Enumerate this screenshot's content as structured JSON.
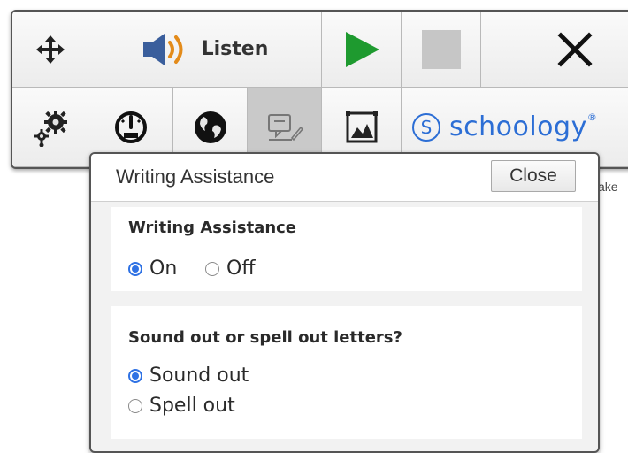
{
  "toolbar": {
    "listen_label": "Listen",
    "schoology_mark": "S",
    "schoology_label": "schoology",
    "schoology_trademark": "®",
    "icons": {
      "move": "move-arrows-icon",
      "speaker": "speaker-icon",
      "play": "play-icon",
      "stop": "stop-icon",
      "close": "close-icon",
      "settings": "gears-icon",
      "speed": "speedometer-icon",
      "globe": "globe-icon",
      "writing": "writing-assistance-icon",
      "picture": "picture-dictionary-icon"
    },
    "colors": {
      "play": "#1e9a2f",
      "speaker": "#3a5e9c",
      "speaker_waves": "#e38b1a",
      "stop": "#c6c6c6",
      "schoology": "#2c6ed5"
    }
  },
  "behind_text": "ake",
  "popup": {
    "title": "Writing Assistance",
    "close_label": "Close",
    "writing_section": {
      "heading": "Writing Assistance",
      "options": [
        {
          "label": "On",
          "selected": true
        },
        {
          "label": "Off",
          "selected": false
        }
      ]
    },
    "sound_section": {
      "heading": "Sound out or spell out letters?",
      "options": [
        {
          "label": "Sound out",
          "selected": true
        },
        {
          "label": "Spell out",
          "selected": false
        }
      ]
    },
    "accent_color": "#2f72e4"
  }
}
